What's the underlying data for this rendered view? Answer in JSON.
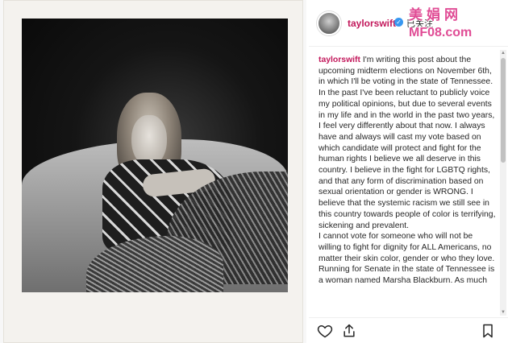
{
  "post": {
    "username": "taylorswift",
    "follow_status": "已关注",
    "watermark": {
      "line1": "美娟网",
      "line2": "MF08.com"
    },
    "caption": {
      "username": "taylorswift",
      "text": "I'm writing this post about the upcoming midterm elections on November 6th, in which I'll be voting in the state of Tennessee. In the past I've been reluctant to publicly voice my political opinions, but due to several events in my life and in the world in the past two years, I feel very differently about that now. I always have and always will cast my vote based on which candidate will protect and fight for the human rights I believe we all deserve in this country. I believe in the fight for LGBTQ rights, and that any form of discrimination based on sexual orientation or gender is WRONG. I believe that the systemic racism we still see in this country towards people of color is terrifying, sickening and prevalent.",
      "text2": "I cannot vote for someone who will not be willing to fight for dignity for ALL Americans, no matter their skin color, gender or who they love. Running for Senate in the state of Tennessee is a woman named Marsha Blackburn. As much"
    },
    "icons": {
      "verified": "verified-badge-icon",
      "heart": "heart-icon",
      "share": "share-icon",
      "bookmark": "bookmark-icon"
    },
    "colors": {
      "username": "#c2185b",
      "verified": "#3897f0",
      "watermark": "#e04c95"
    }
  }
}
